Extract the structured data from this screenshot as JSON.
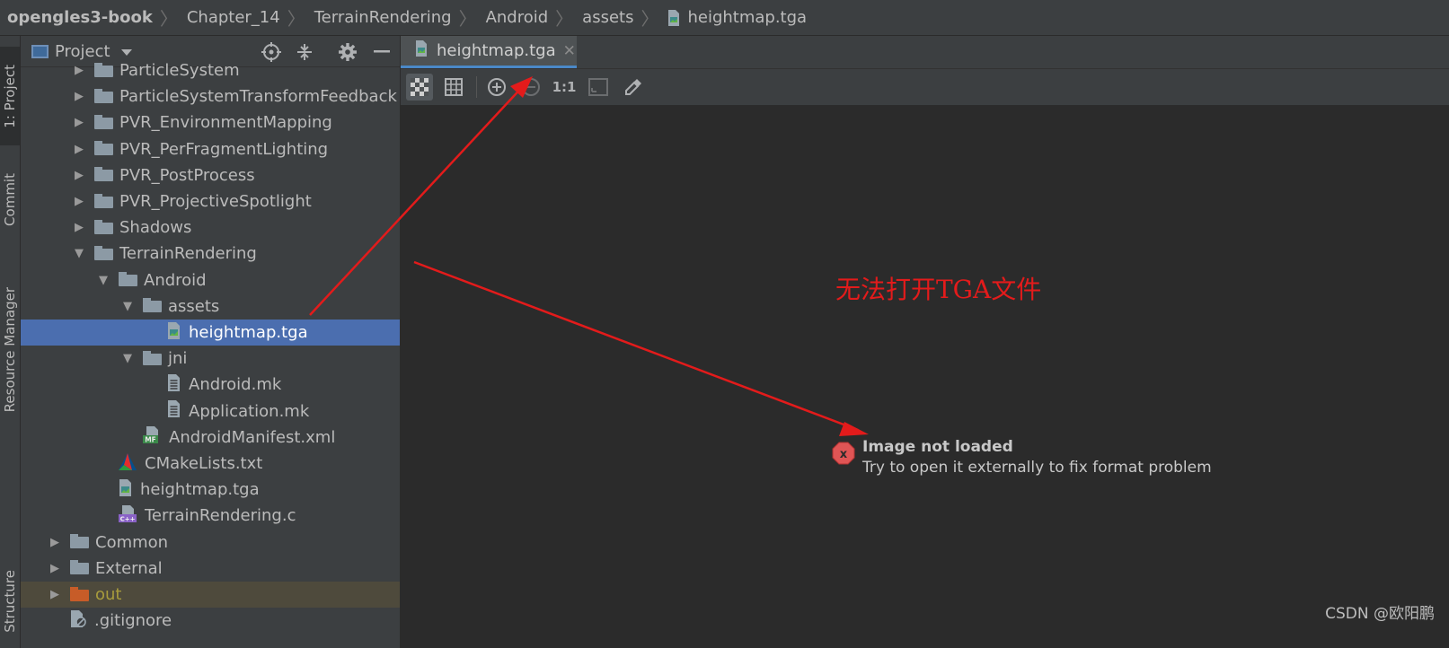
{
  "breadcrumb": [
    "opengles3-book",
    "Chapter_14",
    "TerrainRendering",
    "Android",
    "assets",
    "heightmap.tga"
  ],
  "left_strip": {
    "tabs": [
      "1: Project",
      "Commit",
      "Resource Manager",
      "Structure"
    ]
  },
  "project_panel": {
    "title": "Project",
    "tree": [
      {
        "label": "ParticleSystem",
        "kind": "folder",
        "expanded": false
      },
      {
        "label": "ParticleSystemTransformFeedback",
        "kind": "folder",
        "expanded": false
      },
      {
        "label": "PVR_EnvironmentMapping",
        "kind": "folder",
        "expanded": false
      },
      {
        "label": "PVR_PerFragmentLighting",
        "kind": "folder",
        "expanded": false
      },
      {
        "label": "PVR_PostProcess",
        "kind": "folder",
        "expanded": false
      },
      {
        "label": "PVR_ProjectiveSpotlight",
        "kind": "folder",
        "expanded": false
      },
      {
        "label": "Shadows",
        "kind": "folder",
        "expanded": false
      },
      {
        "label": "TerrainRendering",
        "kind": "folder",
        "expanded": true
      },
      {
        "label": "Android",
        "kind": "folder",
        "expanded": true
      },
      {
        "label": "assets",
        "kind": "folder",
        "expanded": true
      },
      {
        "label": "heightmap.tga",
        "kind": "image-file",
        "selected": true
      },
      {
        "label": "jni",
        "kind": "folder",
        "expanded": true
      },
      {
        "label": "Android.mk",
        "kind": "file"
      },
      {
        "label": "Application.mk",
        "kind": "file"
      },
      {
        "label": "AndroidManifest.xml",
        "kind": "manifest-file"
      },
      {
        "label": "CMakeLists.txt",
        "kind": "cmake-file"
      },
      {
        "label": "heightmap.tga",
        "kind": "image-file"
      },
      {
        "label": "TerrainRendering.c",
        "kind": "c-file"
      },
      {
        "label": "Common",
        "kind": "folder",
        "expanded": false
      },
      {
        "label": "External",
        "kind": "folder",
        "expanded": false
      },
      {
        "label": "out",
        "kind": "excluded-folder",
        "expanded": false
      },
      {
        "label": ".gitignore",
        "kind": "ignore-file"
      }
    ]
  },
  "editor": {
    "tab_label": "heightmap.tga",
    "toolbar_zoom_actual": "1:1",
    "annotation": "无法打开TGA文件",
    "error_title": "Image not loaded",
    "error_message": "Try to open it externally to fix format problem"
  },
  "watermark": "CSDN @欧阳鹏",
  "colors": {
    "background": "#2b2b2b",
    "panel": "#3c3f41",
    "selection": "#4b6eaf",
    "excluded_folder": "#c75c28",
    "annotation_red": "#e31b1b",
    "folder": "#8c9aa5"
  }
}
